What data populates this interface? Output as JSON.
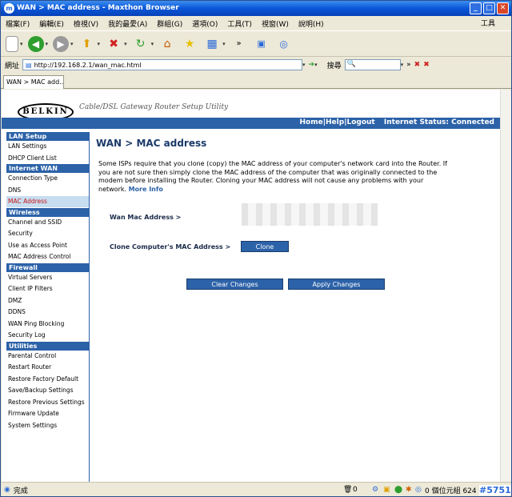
{
  "window": {
    "title": "WAN > MAC address - Maxthon Browser"
  },
  "menu": {
    "items": [
      "檔案(F)",
      "編輯(E)",
      "檢視(V)",
      "我的最愛(A)",
      "群組(G)",
      "選項(O)",
      "工具(T)",
      "視窗(W)",
      "說明(H)"
    ],
    "right": "工具"
  },
  "address": {
    "label": "網址",
    "url": "http://192.168.2.1/wan_mac.html",
    "search_label": "搜尋"
  },
  "tab": {
    "label": "WAN > MAC add..."
  },
  "header": {
    "tagline": "Cable/DSL Gateway Router Setup Utility",
    "logo": "BELKIN",
    "nav_home": "Home",
    "nav_help": "Help",
    "nav_logout": "Logout",
    "status_label": "Internet Status:",
    "status_value": "Connected",
    "sep": "|"
  },
  "sidebar": {
    "sections": [
      {
        "title": "LAN Setup",
        "items": [
          "LAN Settings",
          "DHCP Client List"
        ]
      },
      {
        "title": "Internet WAN",
        "items": [
          "Connection Type",
          "DNS",
          "MAC Address"
        ]
      },
      {
        "title": "Wireless",
        "items": [
          "Channel and SSID",
          "Security",
          "Use as Access Point",
          "MAC Address Control"
        ]
      },
      {
        "title": "Firewall",
        "items": [
          "Virtual Servers",
          "Client IP Filters",
          "DMZ",
          "DDNS",
          "WAN Ping Blocking",
          "Security Log"
        ]
      },
      {
        "title": "Utilities",
        "items": [
          "Parental Control",
          "Restart Router",
          "Restore Factory Default",
          "Save/Backup Settings",
          "Restore Previous Settings",
          "Firmware Update",
          "System Settings"
        ]
      }
    ]
  },
  "main": {
    "title": "WAN > MAC address",
    "description": "Some ISPs require that you clone (copy) the MAC address of your computer's network card into the Router. If you are not sure then simply clone the MAC address of the computer that was originally connected to the modem before installing the Router. Cloning your MAC address will not cause any problems with your network.",
    "more_info": "More Info",
    "wan_mac_label": "Wan Mac Address >",
    "clone_label": "Clone Computer's MAC Address >",
    "clone_button": "Clone",
    "clear_button": "Clear Changes",
    "apply_button": "Apply Changes"
  },
  "status": {
    "text": "完成",
    "count": "0",
    "right": "0 個位元組 624"
  },
  "watermark": "#5751",
  "colors": {
    "brand_blue": "#2c62a8",
    "connected_green": "#2fd12f",
    "active_red": "#c81414"
  }
}
